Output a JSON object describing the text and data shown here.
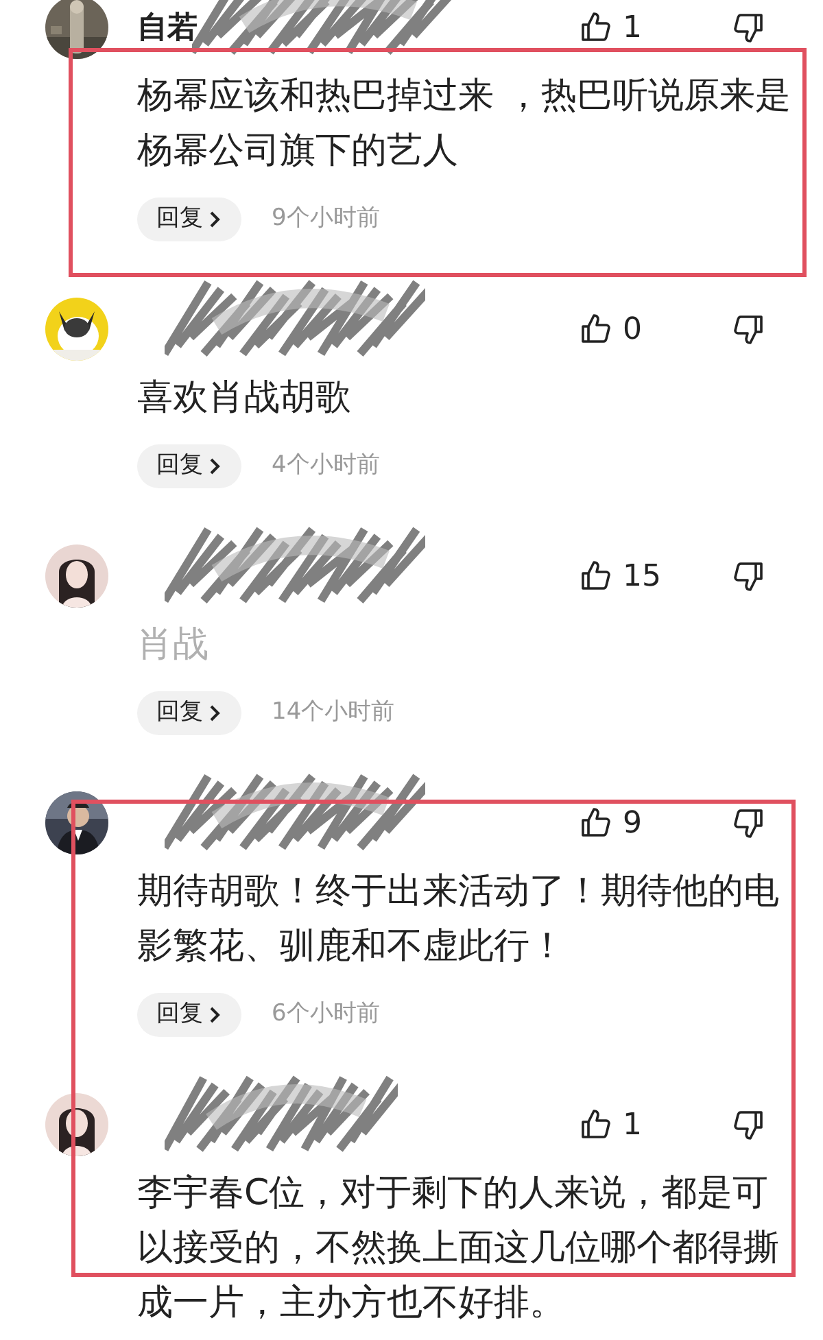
{
  "comments": [
    {
      "name": "自若",
      "likes": "1",
      "text": "杨幂应该和热巴掉过来 ，热巴听说原来是杨幂公司旗下的艺人",
      "reply": "回复",
      "time": "9个小时前",
      "highlighted": true,
      "faded": false
    },
    {
      "likes": "0",
      "text": "喜欢肖战胡歌",
      "reply": "回复",
      "time": "4个小时前",
      "highlighted": false,
      "faded": false
    },
    {
      "likes": "15",
      "text": "肖战",
      "reply": "回复",
      "time": "14个小时前",
      "highlighted": false,
      "faded": true
    },
    {
      "likes": "9",
      "text": "期待胡歌！终于出来活动了！期待他的电影繁花、驯鹿和不虚此行！",
      "reply": "回复",
      "time": "6个小时前",
      "highlighted": true,
      "faded": false
    },
    {
      "likes": "1",
      "text": "李宇春C位，对于剩下的人来说，都是可以接受的，不然换上面这几位哪个都得撕成一片，主办方也不好排。",
      "highlighted": true,
      "faded": false
    }
  ]
}
